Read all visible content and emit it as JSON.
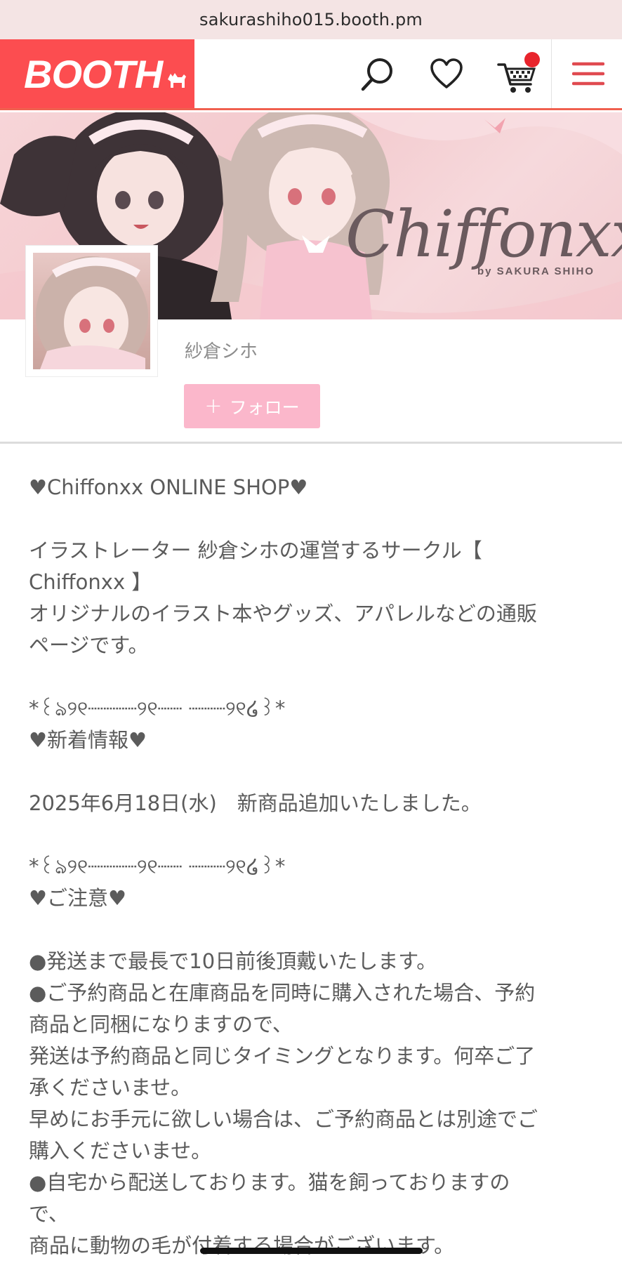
{
  "browser": {
    "url": "sakurashiho015.booth.pm"
  },
  "header": {
    "logo_text": "BOOTH",
    "icons": [
      "search-icon",
      "heart-icon",
      "cart-icon",
      "menu-icon"
    ],
    "accent_color": "#fc4d50",
    "cart_badge_color": "#e8242c"
  },
  "banner": {
    "brand": "Chiffonxx",
    "byline": "by SAKURA SHIHO"
  },
  "profile": {
    "shop_name": "紗倉シホ",
    "follow_label": "フォロー",
    "follow_plus": "+",
    "follow_color": "#fbb7cb"
  },
  "description": {
    "lines": [
      "♥Chiffonxx ONLINE SHOP♥",
      "",
      "イラストレーター 紗倉シホの運営するサークル【",
      "Chiffonxx 】",
      "オリジナルのイラスト本やグッズ、アパレルなどの通販",
      "ページです。",
      "",
      "*꒰ঌ୨୧┈┈┈┈୨୧┈┈ ┈┈┈୨୧໒꒱*",
      "♥新着情報♥",
      "",
      "2025年6月18日(水)　新商品追加いたしました。",
      "",
      "*꒰ঌ୨୧┈┈┈┈୨୧┈┈ ┈┈┈୨୧໒꒱*",
      "♥ご注意♥",
      "",
      "●発送まで最長で10日前後頂戴いたします。",
      "●ご予約商品と在庫商品を同時に購入された場合、予約",
      "商品と同梱になりますので、",
      "発送は予約商品と同じタイミングとなります。何卒ご了",
      "承くださいませ。",
      "早めにお手元に欲しい場合は、ご予約商品とは別途でご",
      "購入くださいませ。",
      "●自宅から配送しております。猫を飼っておりますの",
      "で、",
      "商品に動物の毛が付着する場合がございます。"
    ]
  }
}
